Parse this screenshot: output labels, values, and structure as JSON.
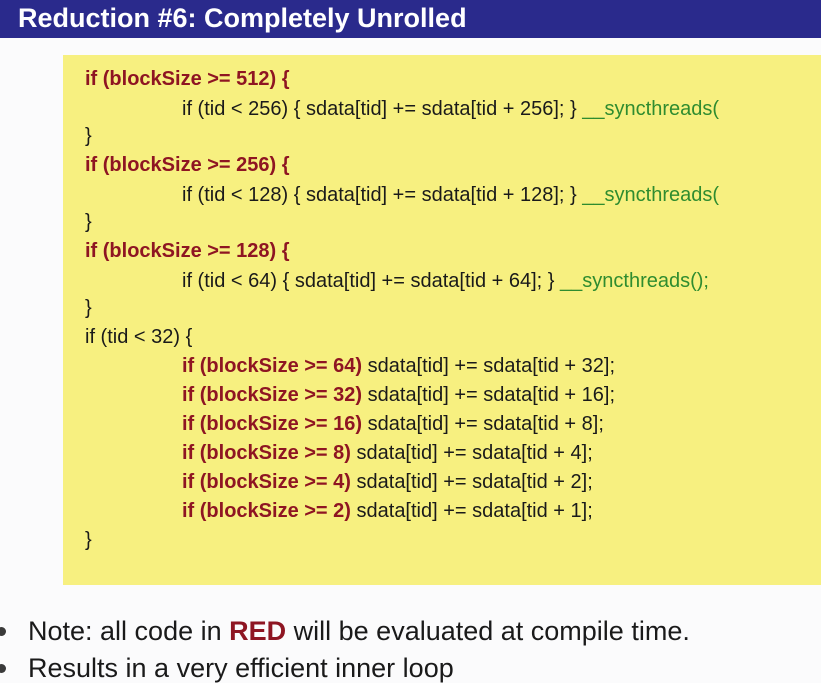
{
  "title": "Reduction #6: Completely Unrolled",
  "code": {
    "l1_cond": "if (blockSize >= 512) {",
    "l2_plain": "if (tid < 256) { sdata[tid] += sdata[tid + 256]; } ",
    "l2_sync": "__syncthreads(",
    "l3": "}",
    "l4_cond": "if (blockSize >= 256) {",
    "l5_plain": "if (tid < 128) { sdata[tid] += sdata[tid + 128]; } ",
    "l5_sync": "__syncthreads(",
    "l6": "}",
    "l7_cond": "if (blockSize >= 128) {",
    "l8_plain": "if (tid < 64) { sdata[tid] += sdata[tid + 64]; } ",
    "l8_sync": "__syncthreads();",
    "l9": "}",
    "l10": "if (tid < 32) {",
    "l11_cond": "if (blockSize >= 64)",
    "l11_plain": " sdata[tid] += sdata[tid + 32];",
    "l12_cond": "if (blockSize >= 32)",
    "l12_plain": " sdata[tid] += sdata[tid + 16];",
    "l13_cond": "if (blockSize >= 16)",
    "l13_plain": " sdata[tid] += sdata[tid + 8];",
    "l14_cond": "if (blockSize >= 8)",
    "l14_plain": " sdata[tid] += sdata[tid + 4];",
    "l15_cond": "if (blockSize >= 4)",
    "l15_plain": " sdata[tid] += sdata[tid + 2];",
    "l16_cond": "if (blockSize >= 2)",
    "l16_plain": " sdata[tid] += sdata[tid + 1];",
    "l17": "}"
  },
  "bullets": {
    "b1_pre": "Note: all code in ",
    "b1_red": "RED",
    "b1_post": " will be evaluated at compile time.",
    "b2": "Results in a very efficient inner loop"
  },
  "colors": {
    "title_bar": "#2a2a8c",
    "code_bg": "#f7f080",
    "red": "#8e1522",
    "green": "#2f8c2f"
  }
}
